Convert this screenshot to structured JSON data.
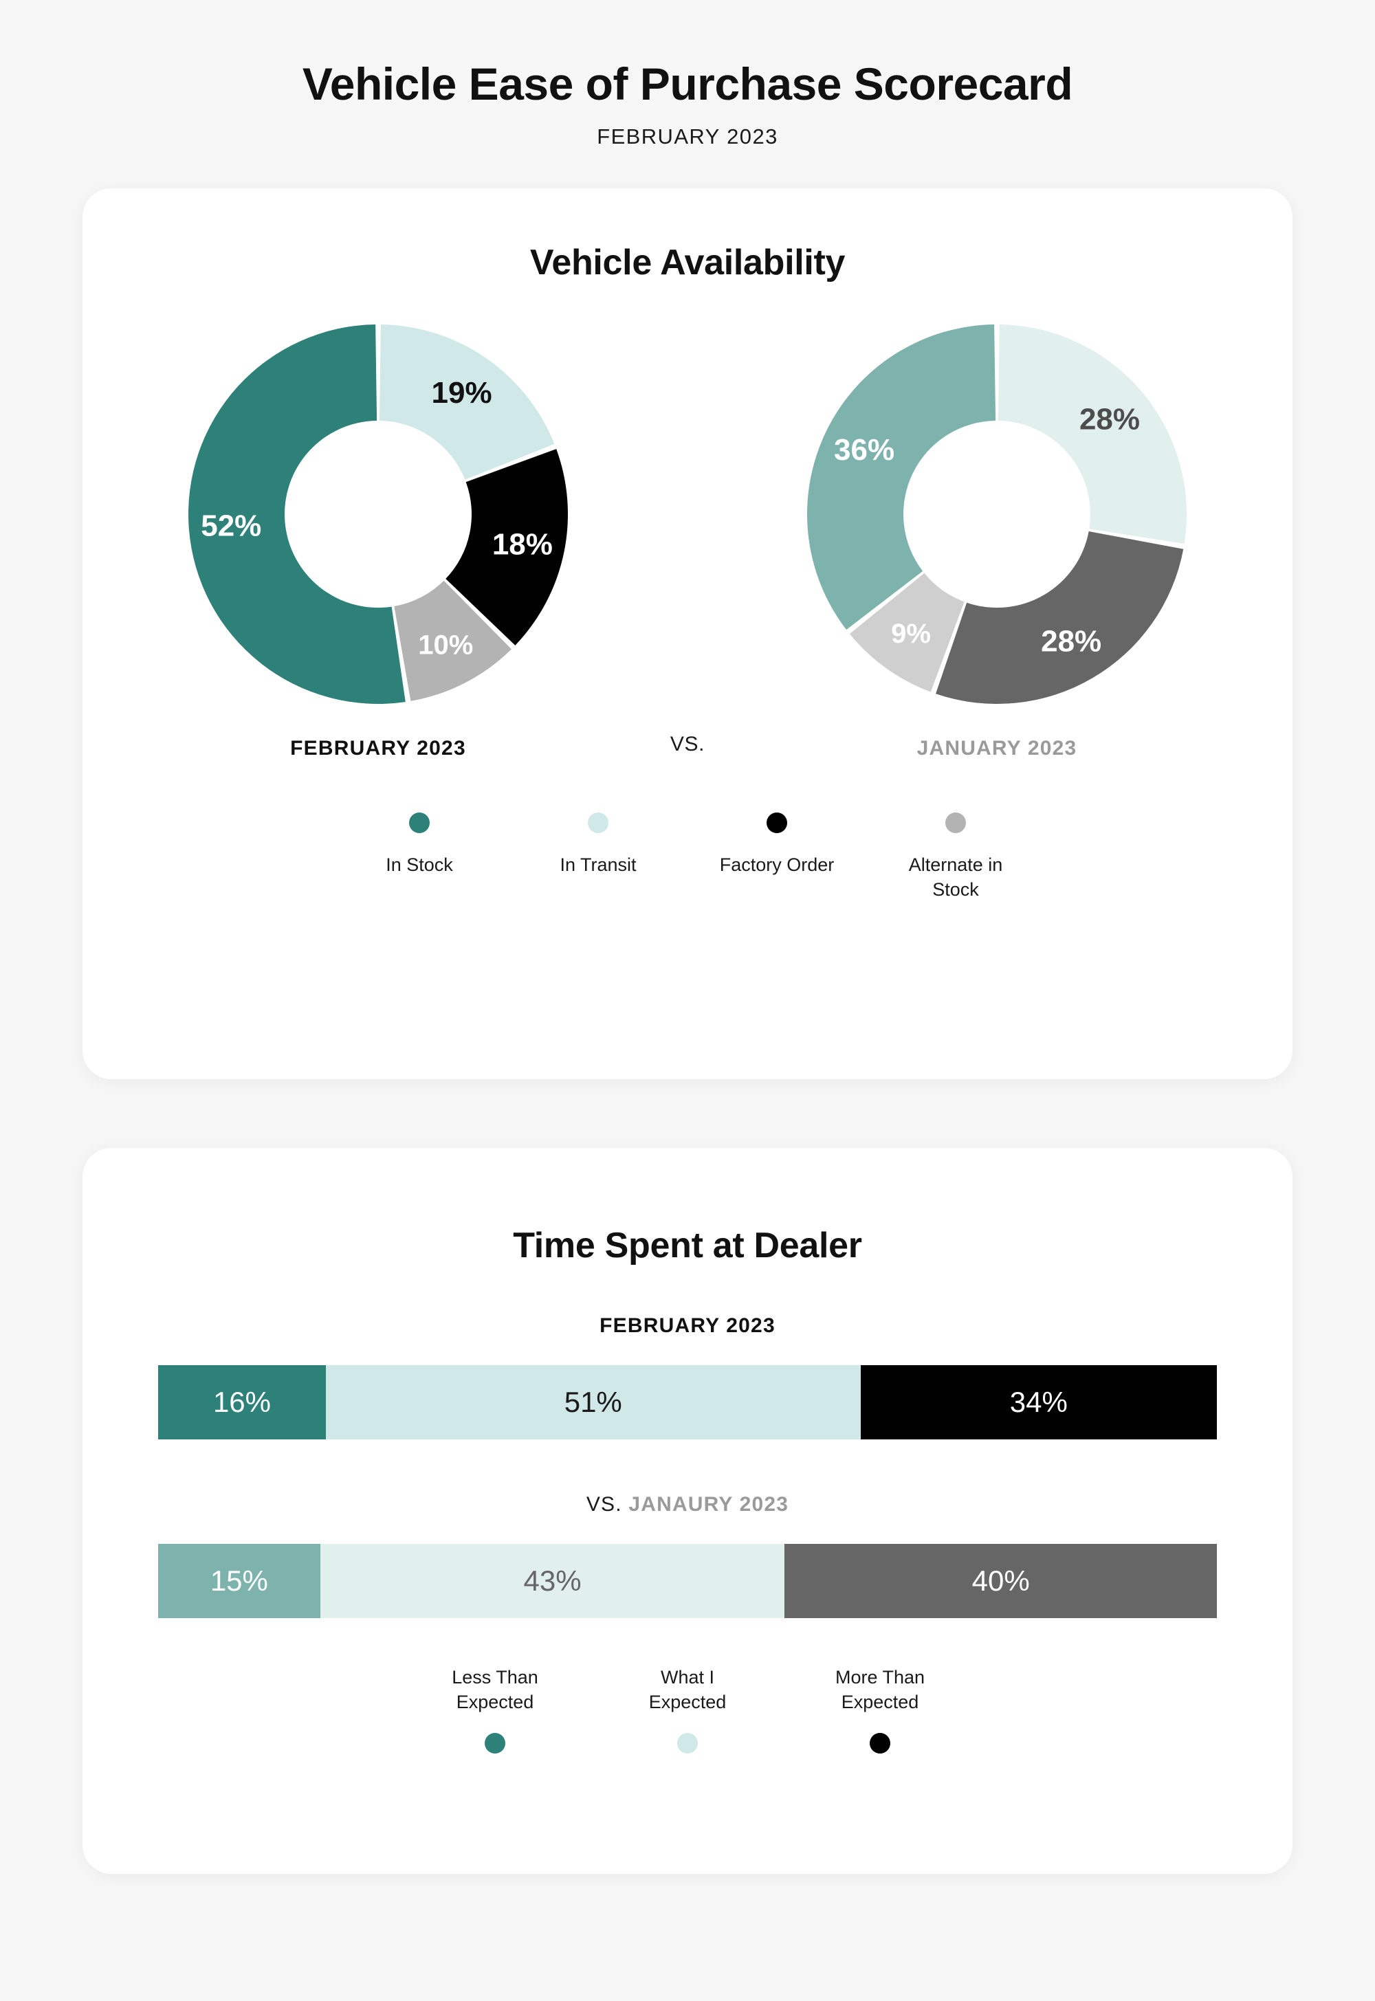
{
  "header": {
    "title": "Vehicle Ease of Purchase Scorecard",
    "subtitle": "FEBRUARY 2023"
  },
  "colors": {
    "teal": "#2E8179",
    "mint": "#D0E8E8",
    "black": "#000000",
    "gray": "#B3B3B3",
    "muted_teal": "#7EB3AD",
    "pale_mint": "#E1EFED",
    "dark_gray": "#666666",
    "light_gray": "#CFCFCF",
    "page_bg": "#F7F7F7",
    "card_bg": "#FFFFFF",
    "prev_label": "#9A9A9A"
  },
  "availability": {
    "title": "Vehicle Availability",
    "current_caption": "FEBRUARY 2023",
    "vs_caption": "VS.",
    "previous_caption": "JANUARY 2023",
    "legend": [
      {
        "label": "In Stock",
        "color": "#2E8179"
      },
      {
        "label": "In Transit",
        "color": "#D0E8E8"
      },
      {
        "label": "Factory Order",
        "color": "#000000"
      },
      {
        "label": "Alternate in Stock",
        "color": "#B3B3B3"
      }
    ]
  },
  "time_at_dealer": {
    "title": "Time Spent at Dealer",
    "current_caption": "FEBRUARY 2023",
    "previous_vs": "VS.",
    "previous_caption": "JANAURY 2023",
    "legend": [
      {
        "label": "Less Than\nExpected",
        "color": "#2E8179"
      },
      {
        "label": "What I\nExpected",
        "color": "#D0E8E8"
      },
      {
        "label": "More Than\nExpected",
        "color": "#000000"
      }
    ]
  },
  "chart_data": [
    {
      "type": "pie",
      "title": "Vehicle Availability",
      "subtitle": "FEBRUARY 2023",
      "variant": "donut",
      "labels": [
        "In Transit",
        "Factory Order",
        "Alternate in Stock",
        "In Stock"
      ],
      "values": [
        19,
        18,
        10,
        52
      ],
      "value_labels": [
        "19%",
        "18%",
        "10%",
        "52%"
      ],
      "colors": [
        "#D0E8E8",
        "#000000",
        "#B3B3B3",
        "#2E8179"
      ],
      "label_text_colors": [
        "#111111",
        "#FFFFFF",
        "#FFFFFF",
        "#FFFFFF"
      ],
      "start_angle_deg": 0,
      "direction": "clockwise",
      "legend_position": "bottom"
    },
    {
      "type": "pie",
      "title": "Vehicle Availability",
      "subtitle": "JANUARY 2023",
      "variant": "donut",
      "labels": [
        "In Transit",
        "Factory Order",
        "Alternate in Stock",
        "In Stock"
      ],
      "values": [
        28,
        28,
        9,
        36
      ],
      "value_labels": [
        "28%",
        "28%",
        "9%",
        "36%"
      ],
      "colors": [
        "#E1EFED",
        "#666666",
        "#CFCFCF",
        "#7EB3AD"
      ],
      "label_text_colors": [
        "#4D4D4D",
        "#FFFFFF",
        "#FFFFFF",
        "#FFFFFF"
      ],
      "start_angle_deg": 0,
      "direction": "clockwise",
      "legend_position": "bottom"
    },
    {
      "type": "bar",
      "orientation": "horizontal",
      "stacked": true,
      "title": "Time Spent at Dealer",
      "subtitle": "FEBRUARY 2023",
      "categories": [
        "Less Than Expected",
        "What I Expected",
        "More Than Expected"
      ],
      "values": [
        16,
        51,
        34
      ],
      "value_labels": [
        "16%",
        "51%",
        "34%"
      ],
      "colors": [
        "#2E8179",
        "#D0E8E8",
        "#000000"
      ],
      "label_text_colors": [
        "#FFFFFF",
        "#1A1A1A",
        "#FFFFFF"
      ],
      "xlim": [
        0,
        101
      ],
      "legend_position": "bottom"
    },
    {
      "type": "bar",
      "orientation": "horizontal",
      "stacked": true,
      "title": "Time Spent at Dealer",
      "subtitle": "JANAURY 2023",
      "categories": [
        "Less Than Expected",
        "What I Expected",
        "More Than Expected"
      ],
      "values": [
        15,
        43,
        40
      ],
      "value_labels": [
        "15%",
        "43%",
        "40%"
      ],
      "colors": [
        "#7EB3AD",
        "#E1EFED",
        "#666666"
      ],
      "label_text_colors": [
        "#FFFFFF",
        "#666666",
        "#FFFFFF"
      ],
      "xlim": [
        0,
        98
      ],
      "legend_position": "bottom"
    }
  ]
}
